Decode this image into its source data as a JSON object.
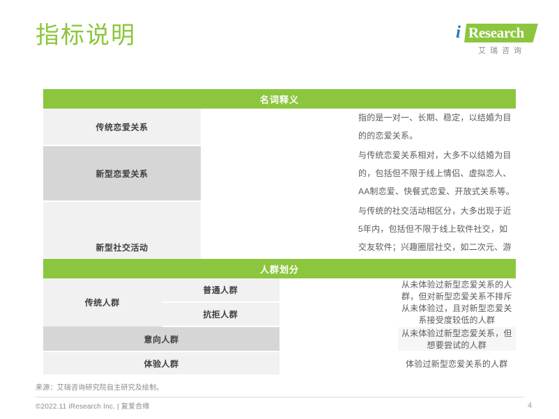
{
  "page": {
    "title": "指标说明",
    "number": "4",
    "accent_color": "#8CC63E",
    "label_color_light": "#f1f1f1",
    "label_color_dark": "#d6d6d6"
  },
  "logo": {
    "i": "i",
    "research": "Research",
    "chinese": "艾瑞咨询",
    "mark_color": "#8CC63E",
    "i_color": "#2E74B5"
  },
  "tables": [
    {
      "header": "名词释义",
      "rows": [
        {
          "label": "传统恋爱关系",
          "label_shade": "light",
          "desc": "指的是一对一、长期、稳定，以结婚为目的的恋爱关系。"
        },
        {
          "label": "新型恋爱关系",
          "label_shade": "dark",
          "desc": "与传统恋爱关系相对，大多不以结婚为目的，包括但不限于线上情侣、虚拟恋人、AA制恋爱、快餐式恋爱、开放式关系等。"
        },
        {
          "label": "新型社交活动",
          "label_shade": "light",
          "desc": "与传统的社交活动相区分，大多出现于近5年内，包括但不限于线上软件社交，如交友软件；兴趣圈层社交，如二次元、游戏、剧本杀、密室等；以及运动社交，如飞盘、露营、橄榄球、桨板等。"
        }
      ]
    },
    {
      "header": "人群划分",
      "group_label": "传统人群",
      "rows": [
        {
          "sub_label": "普通人群",
          "label_shade": "light",
          "desc": "从未体验过新型恋爱关系的人群，但对新型恋爱关系不排斥"
        },
        {
          "sub_label": "抗拒人群",
          "label_shade": "light",
          "desc": "从未体验过，且对新型恋爱关系接受度较低的人群"
        },
        {
          "wide_label": "意向人群",
          "label_shade": "dark",
          "desc": "从未体验过新型恋爱关系，但想要尝试的人群"
        },
        {
          "wide_label": "体验人群",
          "label_shade": "light",
          "desc": "体验过新型恋爱关系的人群"
        }
      ]
    }
  ],
  "footer": {
    "source": "来源：艾瑞咨询研究院自主研究及绘制。",
    "copyright": "©2022.11 iResearch Inc. | 复爱合缘"
  }
}
